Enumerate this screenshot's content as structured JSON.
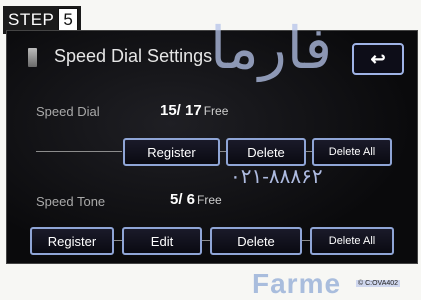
{
  "step": {
    "label": "STEP",
    "number": "5"
  },
  "header": {
    "title": "Speed Dial Settings",
    "back_label": "↩"
  },
  "speed_dial": {
    "label": "Speed Dial",
    "count": "15/ 17",
    "free": "Free",
    "buttons": {
      "register": "Register",
      "delete": "Delete",
      "delete_all": "Delete All"
    }
  },
  "speed_tone": {
    "label": "Speed Tone",
    "count": "5/ 6",
    "free": "Free",
    "buttons": {
      "register": "Register",
      "edit": "Edit",
      "delete": "Delete",
      "delete_all": "Delete All"
    }
  },
  "watermarks": {
    "brand": "Farme",
    "phone": "۰۲۱-۸۸۸۶۲",
    "script": "فارما",
    "corner": "© C:OVA402"
  }
}
